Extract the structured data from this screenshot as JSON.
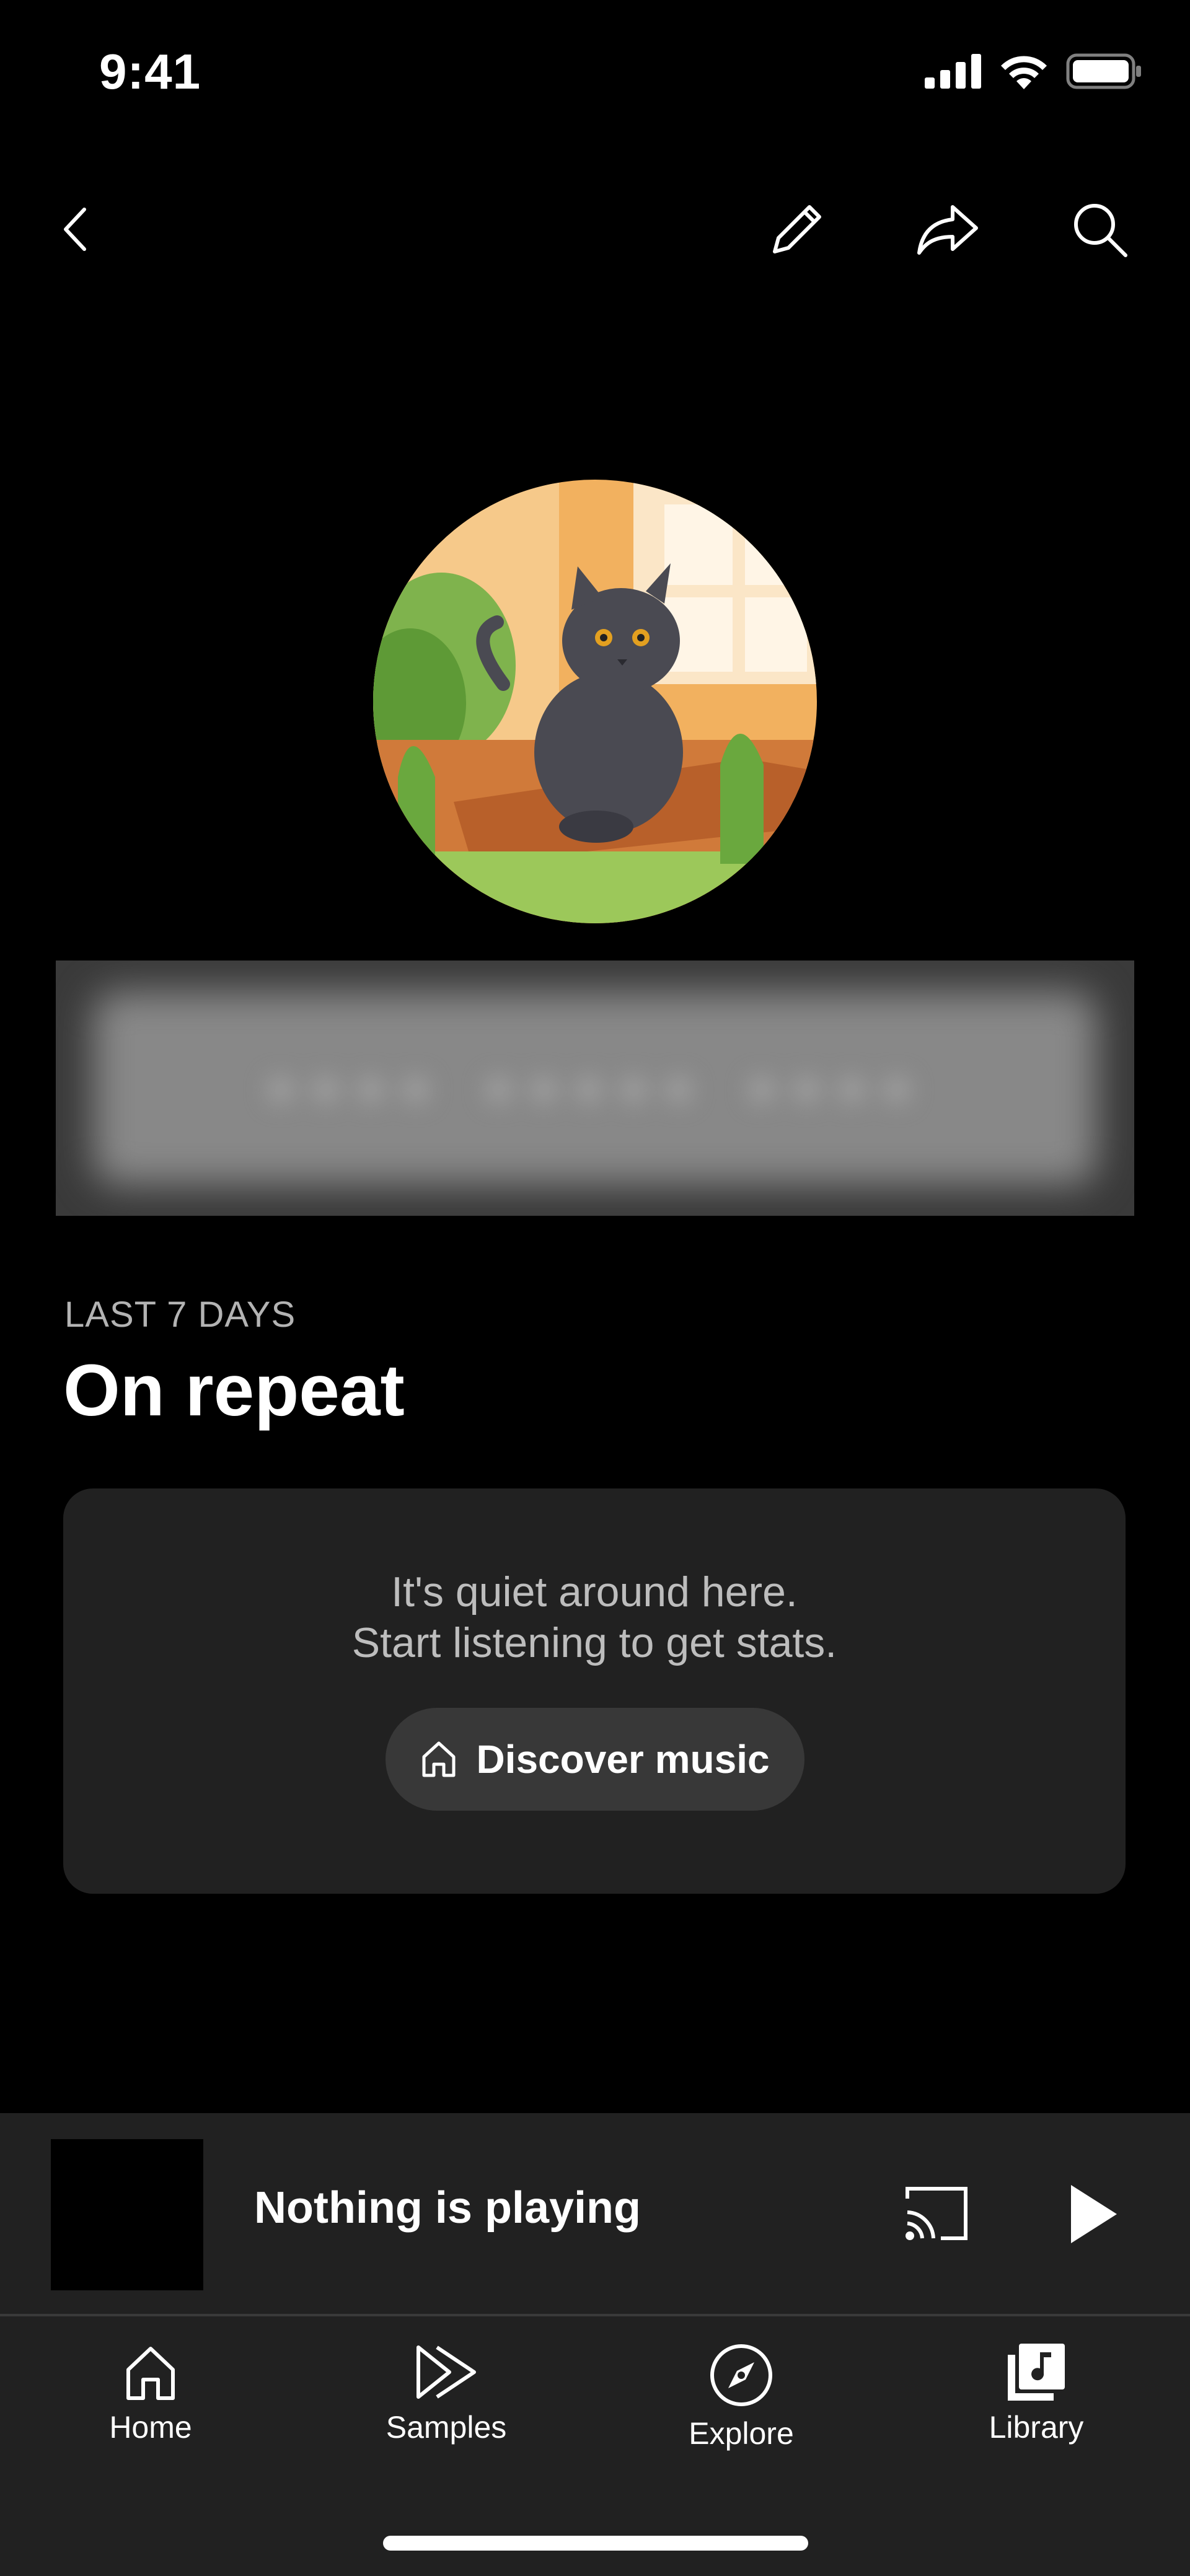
{
  "status_bar": {
    "time": "9:41"
  },
  "profile": {
    "blurred_name": "•••• ••••• ••••"
  },
  "section": {
    "kicker": "LAST 7 DAYS",
    "title": "On repeat",
    "empty_line1": "It's quiet around here.",
    "empty_line2": "Start listening to get stats.",
    "button_label": "Discover music"
  },
  "mini_player": {
    "title": "Nothing is playing"
  },
  "bottom_nav": {
    "items": [
      {
        "label": "Home",
        "icon": "home-icon"
      },
      {
        "label": "Samples",
        "icon": "samples-icon"
      },
      {
        "label": "Explore",
        "icon": "explore-icon"
      },
      {
        "label": "Library",
        "icon": "library-icon"
      }
    ]
  },
  "colors": {
    "background": "#000000",
    "card": "#212121",
    "button": "#383838",
    "muted_text": "#b3b3b3"
  }
}
